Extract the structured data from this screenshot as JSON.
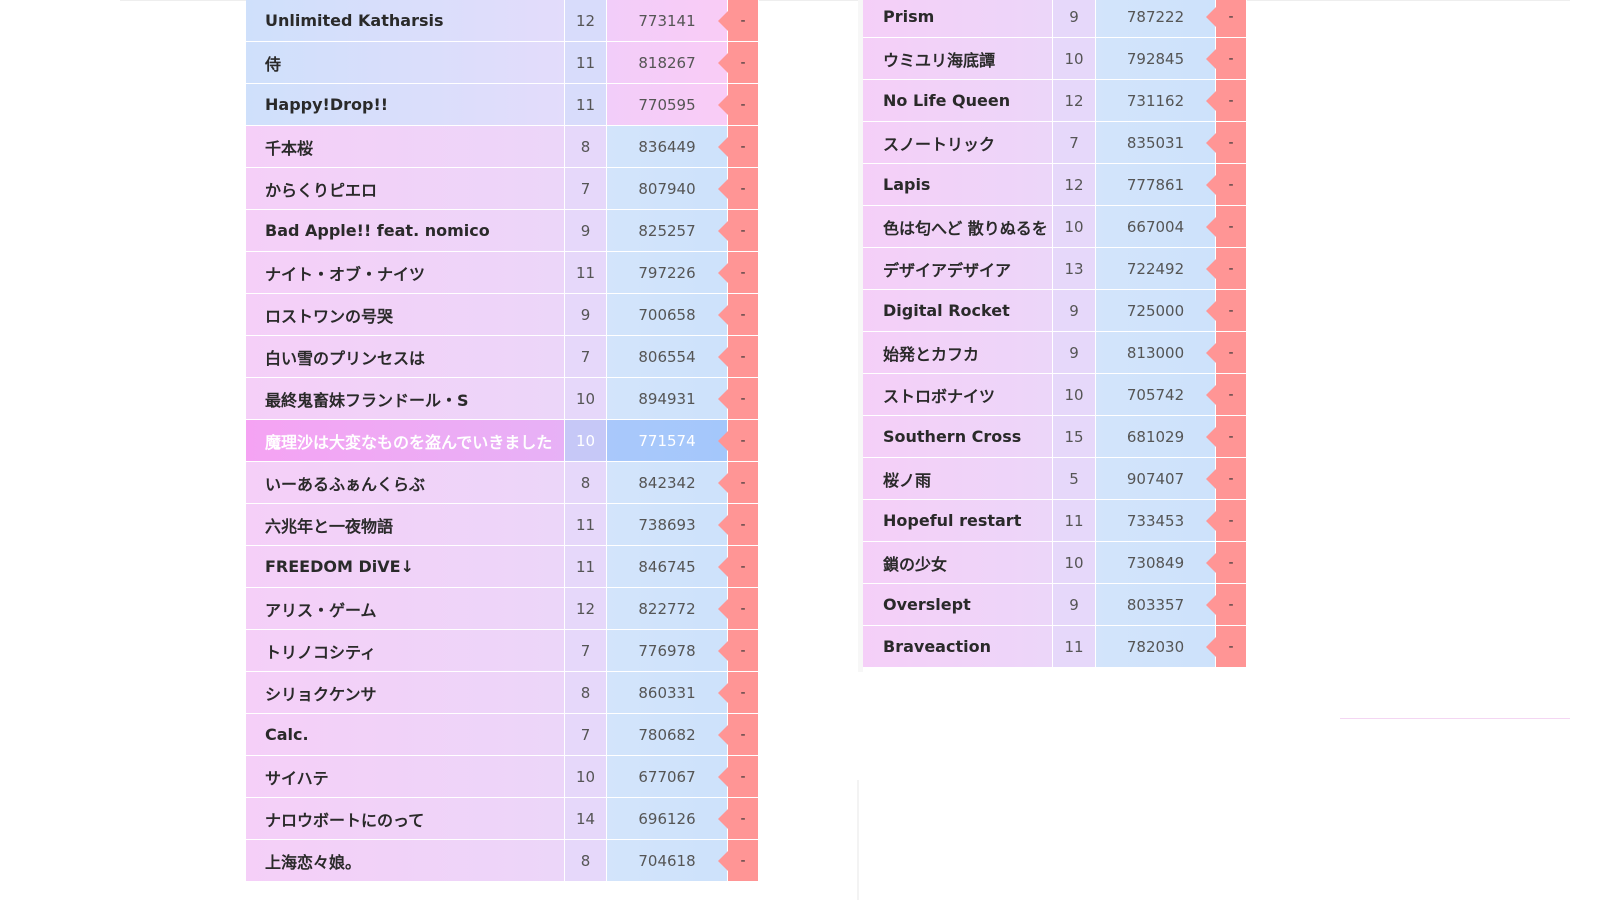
{
  "left_table": {
    "rows": [
      {
        "title": "Unlimited Katharsis",
        "level": "12",
        "score": "773141",
        "status": "-",
        "theme": "blue"
      },
      {
        "title": "侍",
        "level": "11",
        "score": "818267",
        "status": "-",
        "theme": "blue"
      },
      {
        "title": "Happy!Drop!!",
        "level": "11",
        "score": "770595",
        "status": "-",
        "theme": "blue"
      },
      {
        "title": "千本桜",
        "level": "8",
        "score": "836449",
        "status": "-",
        "theme": "pink"
      },
      {
        "title": "からくりピエロ",
        "level": "7",
        "score": "807940",
        "status": "-",
        "theme": "pink"
      },
      {
        "title": "Bad Apple!! feat. nomico",
        "level": "9",
        "score": "825257",
        "status": "-",
        "theme": "pink"
      },
      {
        "title": "ナイト・オブ・ナイツ",
        "level": "11",
        "score": "797226",
        "status": "-",
        "theme": "pink"
      },
      {
        "title": "ロストワンの号哭",
        "level": "9",
        "score": "700658",
        "status": "-",
        "theme": "pink"
      },
      {
        "title": "白い雪のプリンセスは",
        "level": "7",
        "score": "806554",
        "status": "-",
        "theme": "pink"
      },
      {
        "title": "最終鬼畜妹フランドール・S",
        "level": "10",
        "score": "894931",
        "status": "-",
        "theme": "pink"
      },
      {
        "title": "魔理沙は大変なものを盗んでいきました",
        "level": "10",
        "score": "771574",
        "status": "-",
        "theme": "highlight"
      },
      {
        "title": "いーあるふぁんくらぶ",
        "level": "8",
        "score": "842342",
        "status": "-",
        "theme": "pink"
      },
      {
        "title": "六兆年と一夜物語",
        "level": "11",
        "score": "738693",
        "status": "-",
        "theme": "pink"
      },
      {
        "title": "FREEDOM DiVE↓",
        "level": "11",
        "score": "846745",
        "status": "-",
        "theme": "pink"
      },
      {
        "title": "アリス・ゲーム",
        "level": "12",
        "score": "822772",
        "status": "-",
        "theme": "pink"
      },
      {
        "title": "トリノコシティ",
        "level": "7",
        "score": "776978",
        "status": "-",
        "theme": "pink"
      },
      {
        "title": "シリョクケンサ",
        "level": "8",
        "score": "860331",
        "status": "-",
        "theme": "pink"
      },
      {
        "title": "Calc.",
        "level": "7",
        "score": "780682",
        "status": "-",
        "theme": "pink"
      },
      {
        "title": "サイハテ",
        "level": "10",
        "score": "677067",
        "status": "-",
        "theme": "pink"
      },
      {
        "title": "ナロウボートにのって",
        "level": "14",
        "score": "696126",
        "status": "-",
        "theme": "pink"
      },
      {
        "title": "上海恋々娘。",
        "level": "8",
        "score": "704618",
        "status": "-",
        "theme": "pink"
      }
    ]
  },
  "right_table": {
    "rows": [
      {
        "title": "Prism",
        "level": "9",
        "score": "787222",
        "status": "-",
        "theme": "pink"
      },
      {
        "title": "ウミユリ海底譚",
        "level": "10",
        "score": "792845",
        "status": "-",
        "theme": "pink"
      },
      {
        "title": "No Life Queen",
        "level": "12",
        "score": "731162",
        "status": "-",
        "theme": "pink"
      },
      {
        "title": "スノートリック",
        "level": "7",
        "score": "835031",
        "status": "-",
        "theme": "pink"
      },
      {
        "title": "Lapis",
        "level": "12",
        "score": "777861",
        "status": "-",
        "theme": "pink"
      },
      {
        "title": "色は匂へど 散りぬるを",
        "level": "10",
        "score": "667004",
        "status": "-",
        "theme": "pink"
      },
      {
        "title": "デザイアデザイア",
        "level": "13",
        "score": "722492",
        "status": "-",
        "theme": "pink"
      },
      {
        "title": "Digital Rocket",
        "level": "9",
        "score": "725000",
        "status": "-",
        "theme": "pink"
      },
      {
        "title": "始発とカフカ",
        "level": "9",
        "score": "813000",
        "status": "-",
        "theme": "pink"
      },
      {
        "title": "ストロボナイツ",
        "level": "10",
        "score": "705742",
        "status": "-",
        "theme": "pink"
      },
      {
        "title": "Southern Cross",
        "level": "15",
        "score": "681029",
        "status": "-",
        "theme": "pink"
      },
      {
        "title": "桜ノ雨",
        "level": "5",
        "score": "907407",
        "status": "-",
        "theme": "pink"
      },
      {
        "title": "Hopeful restart",
        "level": "11",
        "score": "733453",
        "status": "-",
        "theme": "pink"
      },
      {
        "title": "鎖の少女",
        "level": "10",
        "score": "730849",
        "status": "-",
        "theme": "pink"
      },
      {
        "title": "Overslept",
        "level": "9",
        "score": "803357",
        "status": "-",
        "theme": "pink"
      },
      {
        "title": "Braveaction",
        "level": "11",
        "score": "782030",
        "status": "-",
        "theme": "pink"
      }
    ]
  },
  "colors": {
    "status_red": "#ff9595",
    "row_pink": "#f5cff8",
    "row_blue": "#cfe0fb",
    "highlight_pink": "#f5a3f3",
    "highlight_blue": "#a9c8fb"
  }
}
